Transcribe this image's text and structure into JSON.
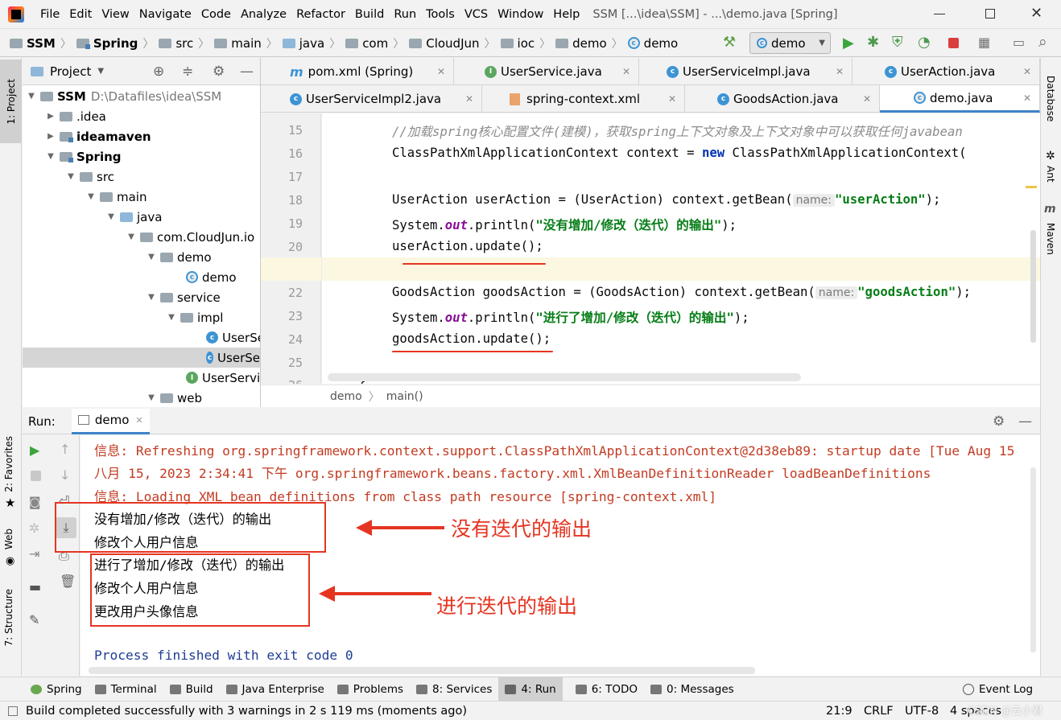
{
  "menubar": {
    "items": [
      "File",
      "Edit",
      "View",
      "Navigate",
      "Code",
      "Analyze",
      "Refactor",
      "Build",
      "Run",
      "Tools",
      "VCS",
      "Window",
      "Help"
    ],
    "window_title": "SSM [...\\idea\\SSM] - ...\\demo.java [Spring]"
  },
  "navbar": {
    "crumbs": [
      "SSM",
      "Spring",
      "src",
      "main",
      "java",
      "com",
      "CloudJun",
      "ioc",
      "demo",
      "demo"
    ],
    "run_config": "demo"
  },
  "left_strip": {
    "project": "1: Project",
    "favorites": "2: Favorites",
    "web": "Web",
    "structure": "7: Structure"
  },
  "right_strip": {
    "database": "Database",
    "ant": "Ant",
    "maven": "Maven"
  },
  "project_panel": {
    "title": "Project",
    "root_path": "D:\\Datafiles\\idea\\SSM",
    "tree": [
      "SSM",
      ".idea",
      "ideamaven",
      "Spring",
      "src",
      "main",
      "java",
      "com.CloudJun.io",
      "demo",
      "demo",
      "service",
      "impl",
      "UserSe",
      "UserSe",
      "UserServi",
      "web"
    ]
  },
  "tabs_row1": [
    "pom.xml (Spring)",
    "UserService.java",
    "UserServiceImpl.java",
    "UserAction.java"
  ],
  "tabs_row2": [
    "UserServiceImpl2.java",
    "spring-context.xml",
    "GoodsAction.java",
    "demo.java"
  ],
  "editor": {
    "line_numbers": [
      "15",
      "16",
      "17",
      "18",
      "19",
      "20",
      "21",
      "22",
      "23",
      "24",
      "25",
      "26"
    ],
    "comment": "//加载spring核心配置文件(建模)，获取spring上下文对象及上下文对象中可以获取任何javabean",
    "l16": {
      "type": "ClassPathXmlApplicationContext",
      "var": "context",
      "eq": "=",
      "kw": "new",
      "ctor": "ClassPathXmlApplicationContext("
    },
    "l18": {
      "pre": "UserAction userAction  = (UserAction) context.getBean(",
      "hint": "name:",
      "str": "\"userAction\"",
      "post": ");"
    },
    "l19": {
      "pre": "System.",
      "field": "out",
      "mid": ".println(",
      "str": "\"没有增加/修改（迭代）的输出\"",
      "post": ");"
    },
    "l20": "userAction.update();",
    "l22": {
      "pre": "GoodsAction goodsAction = (GoodsAction) context.getBean(",
      "hint": "name:",
      "str": "\"goodsAction\"",
      "post": ");"
    },
    "l23": {
      "pre": "System.",
      "field": "out",
      "mid": ".println(",
      "str": "\"进行了增加/修改（迭代）的输出\"",
      "post": ");"
    },
    "l24": "goodsAction.update();",
    "l26": "}"
  },
  "editor_breadcrumb": [
    "demo",
    "main()"
  ],
  "run_panel": {
    "label": "Run:",
    "tab": "demo",
    "console": [
      "信息: Refreshing org.springframework.context.support.ClassPathXmlApplicationContext@2d38eb89: startup date [Tue Aug 15",
      "八月 15, 2023 2:34:41 下午 org.springframework.beans.factory.xml.XmlBeanDefinitionReader loadBeanDefinitions",
      "信息: Loading XML bean definitions from class path resource [spring-context.xml]",
      "没有增加/修改（迭代）的输出",
      "修改个人用户信息",
      "进行了增加/修改（迭代）的输出",
      "修改个人用户信息",
      "更改用户头像信息",
      "Process finished with exit code 0"
    ],
    "annotation_1": "没有迭代的输出",
    "annotation_2": "进行迭代的输出"
  },
  "bottom_tools": [
    "Spring",
    "Terminal",
    "Build",
    "Java Enterprise",
    "Problems",
    "8: Services",
    "4: Run",
    "6: TODO",
    "0: Messages",
    "Event Log"
  ],
  "status": {
    "message": "Build completed successfully with 3 warnings in 2 s 119 ms (moments ago)",
    "position": "21:9",
    "line_sep": "CRLF",
    "encoding": "UTF-8",
    "indent": "4 spaces",
    "watermark": "CSDN @云小君"
  },
  "colors": {
    "keyword": "#0033b3",
    "string": "#067d17",
    "annotation": "#e53521",
    "log_red": "#c23b22",
    "accent": "#4083c9"
  }
}
